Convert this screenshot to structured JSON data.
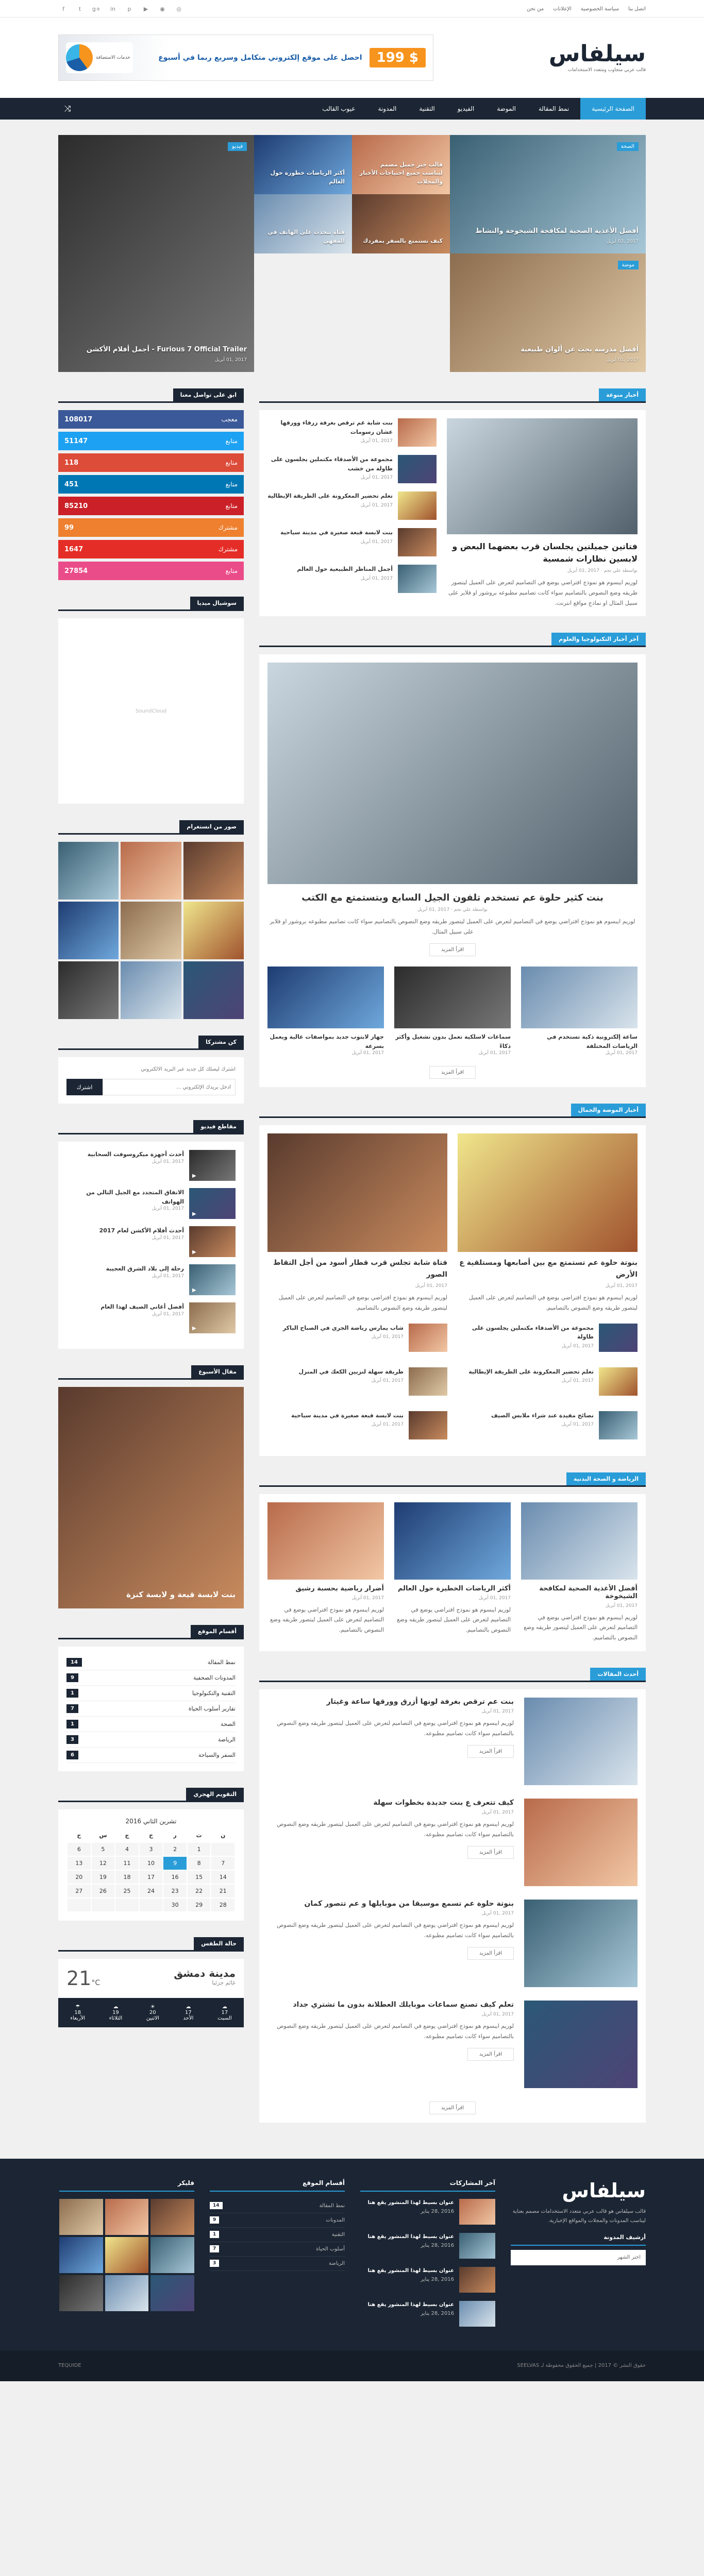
{
  "topbar": {
    "links": [
      "اتصل بنا",
      "سياسة الخصوصية",
      "الإعلانات",
      "من نحن"
    ],
    "socials": [
      "facebook-icon",
      "twitter-icon",
      "google-plus-icon",
      "linkedin-icon",
      "pinterest-icon",
      "youtube-icon",
      "rss-icon",
      "instagram-icon"
    ]
  },
  "header": {
    "logo": "سيلفاس",
    "tagline": "قالب عربي متجاوب ومتعدد الاستخدامات",
    "ad_text": "احصل على موقع إلكتروني متكامل وسريع ربما في أسبوع",
    "ad_brand": "خدمات الاستضافة",
    "ad_price": "199 $"
  },
  "nav": {
    "items": [
      "الصفحة الرئيسية",
      "نمط المقالة",
      "الموضة",
      "الفيديو",
      "التقنية",
      "المدونة",
      "عيوب القالب"
    ]
  },
  "slider": [
    {
      "title": "أفضل الأغذية الصحية لمكافحة الشيخوخة والنشاط",
      "meta": "2017 ,02 أبريل",
      "badge": "الصحة"
    },
    {
      "title": "قالب خبر جميل مصمم ليناسب جميع احتياجات الأخبار والمجلات",
      "meta": "2017 ,01 أبريل",
      "badge": "تقنية"
    },
    {
      "title": "أكثر الرياضات خطورة حول العالم",
      "meta": "2017 ,01 أبريل",
      "badge": "رياضة"
    },
    {
      "title": "كيف تستمتع بالسفر بمفردك",
      "meta": "2017 ,01 أبريل",
      "badge": "سفر"
    },
    {
      "title": "فتاة تتحدث على الهاتف في المقهى",
      "meta": "2017 ,01 أبريل",
      "badge": "أسلوب حياة"
    },
    {
      "title": "Furious 7 Official Trailer - أجمل أفلام الأكشن",
      "meta": "2017 ,01 أبريل",
      "badge": "فيديو"
    },
    {
      "title": "أفضل مدرسة بحث عن ألوان طبيعية",
      "meta": "2017 ,01 أبريل",
      "badge": "موضة"
    }
  ],
  "sections": {
    "news": "أخبار منوعة",
    "tech": "آخر أخبار التكنولوجيا والعلوم",
    "fashion": "أخبار الموضة والجمال",
    "sports": "الرياضة و الصحة البدنية",
    "latest": "أحدث المقالات"
  },
  "featured": {
    "title": "فتاتين جميلتين يجلسان قرب بعضهما البعض و لابسين نظارات شمسية",
    "meta": "بواسطة علي نجم · 2017 ,01 أبريل",
    "excerpt": "لوريم ايبسوم هو نموذج افتراضي يوضع في التصاميم لتعرض على العميل ليتصور طريقه وضع النصوص بالتصاميم سواء كانت تصاميم مطبوعه بروشور او فلاير على سبيل المثال او نماذج مواقع انترنت.",
    "list": [
      {
        "t": "بنت شابة عم ترقص بغرفة زرقاء وورقها عشان رسومات",
        "m": "2017 ,01 أبريل"
      },
      {
        "t": "مجموعة من الأصدقاء مكتملين يجلسون على طاولة من خشب",
        "m": "2017 ,01 أبريل"
      },
      {
        "t": "تعلم تحضير المعكرونة على الطريقة الإيطالية",
        "m": "2017 ,01 أبريل"
      },
      {
        "t": "بنت لابسة قبعة صغيرة في مدينة سياحية",
        "m": "2017 ,01 أبريل"
      },
      {
        "t": "أجمل المناظر الطبيعية حول العالم",
        "m": "2017 ,01 أبريل"
      }
    ]
  },
  "tech": {
    "title": "بنت كثير حلوة عم تستخدم تلفون الجيل السابع وبتستمتع مع الكتب",
    "meta": "بواسطة علي نجم · 2017 ,01 أبريل",
    "excerpt": "لوريم ايبسوم هو نموذج افتراضي يوضع في التصاميم لتعرض على العميل ليتصور طريقه وضع النصوص بالتصاميم سواء كانت تصاميم مطبوعه بروشور او فلاير على سبيل المثال.",
    "more": "اقرأ المزيد",
    "cards": [
      {
        "t": "ساعة إلكترونية ذكية تستخدم في الرياضات المختلفة",
        "m": "2017 ,01 أبريل"
      },
      {
        "t": "سماعات لاسلكية تعمل بدون تشغيل وأكثر ذكاءً",
        "m": "2017 ,01 أبريل"
      },
      {
        "t": "جهاز لابتوب جديد بمواصفات عالية ويعمل بسرعة",
        "m": "2017 ,01 أبريل"
      }
    ]
  },
  "fashion": {
    "a": {
      "t": "بنوتة حلوة عم تستمتع مع بين أصابعها ومستلقية ع الأرض",
      "m": "2017 ,01 أبريل"
    },
    "b": {
      "t": "فتاة شابة تجلس قرب قطار أسود من أجل التقاط الصور",
      "m": "2017 ,01 أبريل"
    },
    "excerpt": "لوريم ايبسوم هو نموذج افتراضي يوضع في التصاميم لتعرض على العميل ليتصور طريقه وضع النصوص بالتصاميم.",
    "list": [
      {
        "t": "مجموعة من الأصدقاء مكتملين يجلسون على طاولة",
        "m": "2017 ,01 أبريل"
      },
      {
        "t": "شاب يمارس رياضة الجري في الصباح الباكر",
        "m": "2017 ,01 أبريل"
      },
      {
        "t": "تعلم تحضير المعكرونة على الطريقة الإيطالية",
        "m": "2017 ,01 أبريل"
      },
      {
        "t": "طريقة سهلة لتزيين الكعك في المنزل",
        "m": "2017 ,01 أبريل"
      },
      {
        "t": "نصائح مفيدة عند شراء ملابس الصيف",
        "m": "2017 ,01 أبريل"
      },
      {
        "t": "بنت لابسة قبعة صغيرة في مدينة سياحية",
        "m": "2017 ,01 أبريل"
      }
    ]
  },
  "sports": [
    {
      "t": "أفضل الأغذية الصحية لمكافحة الشيخوخة",
      "m": "2017 ,01 أبريل"
    },
    {
      "t": "أكثر الرياضات الخطيرة حول العالم",
      "m": "2017 ,01 أبريل"
    },
    {
      "t": "أضرار رياضية بحسبة رشيق",
      "m": "2017 ,01 أبريل"
    }
  ],
  "latest": [
    {
      "t": "بنت عم ترقص بغرفة لونها أزرق وورقها ساعة وغيتار",
      "m": "2017 ,01 أبريل"
    },
    {
      "t": "كيف تتعرف ع بنت جديدة بخطوات سهلة",
      "m": "2017 ,01 أبريل"
    },
    {
      "t": "بنوتة حلوة عم تسمع موسيقا من موبايلها و عم تتصور كمان",
      "m": "2017 ,01 أبريل"
    },
    {
      "t": "تعلم كيف تصنع سماعات موبايلك العطلانة بدون ما تشتري جداد",
      "m": "2017 ,01 أبريل"
    }
  ],
  "latest_excerpt": "لوريم ايبسوم هو نموذج افتراضي يوضع في التصاميم لتعرض على العميل ليتصور طريقه وضع النصوص بالتصاميم سواء كانت تصاميم مطبوعه.",
  "sidebar": {
    "counter_title": "ابق على تواصل معنا",
    "counters": [
      {
        "name": "معجب",
        "value": "108017",
        "color": "#3b5998"
      },
      {
        "name": "متابع",
        "value": "51147",
        "color": "#1da1f2"
      },
      {
        "name": "متابع",
        "value": "118",
        "color": "#dd4b39"
      },
      {
        "name": "متابع",
        "value": "451",
        "color": "#0077b5"
      },
      {
        "name": "متابع",
        "value": "85210",
        "color": "#cb2027"
      },
      {
        "name": "مشترك",
        "value": "99",
        "color": "#ee802f"
      },
      {
        "name": "مشترك",
        "value": "1647",
        "color": "#e52d27"
      },
      {
        "name": "متابع",
        "value": "27854",
        "color": "#ea4c89"
      }
    ],
    "social_title": "سوشيال ميديا",
    "insta_title": "صور من انستغرام",
    "newsletter_title": "كن مشتركا",
    "newsletter_text": "اشترك ليصلك كل جديد عبر البريد الالكتروني",
    "newsletter_placeholder": "أدخل بريدك الإلكتروني ...",
    "newsletter_btn": "اشترك",
    "videos_title": "مقاطع فيديو",
    "videos": [
      {
        "t": "أحدث أجهزة ميكروسوفت السحابية",
        "m": "2017 ,01 أبريل"
      },
      {
        "t": "الاتفاق المتجدد مع الجيل التالي من الهواتف",
        "m": "2017 ,01 أبريل"
      },
      {
        "t": "أحدث أفلام الأكشن لعام 2017",
        "m": "2017 ,01 أبريل"
      },
      {
        "t": "رحلة إلى بلاد الشرق العجيبة",
        "m": "2017 ,01 أبريل"
      },
      {
        "t": "أفضل أغاني الصيف لهذا العام",
        "m": "2017 ,01 أبريل"
      }
    ],
    "post_title": "مقال الأسبوع",
    "post_caption": "بنت لابسة قبعة و لابسة كنزة",
    "cats_title": "أقسام الموقع",
    "cats": [
      {
        "n": "نمط المقالة",
        "c": "14"
      },
      {
        "n": "المدونات الصحفية",
        "c": "9"
      },
      {
        "n": "التقنية والتكنولوجيا",
        "c": "1"
      },
      {
        "n": "تقارير أسلوب الحياة",
        "c": "7"
      },
      {
        "n": "الصحة",
        "c": "1"
      },
      {
        "n": "الرياضة",
        "c": "3"
      },
      {
        "n": "السفر والسياحة",
        "c": "6"
      }
    ],
    "cal_title": "التقويم الهجري",
    "cal_month": "تشرين الثاني 2016",
    "cal_days": [
      "ن",
      "ث",
      "ر",
      "خ",
      "ج",
      "س",
      "ح"
    ],
    "cal_weeks": [
      [
        "",
        "1",
        "2",
        "3",
        "4",
        "5",
        "6"
      ],
      [
        "7",
        "8",
        "9",
        "10",
        "11",
        "12",
        "13"
      ],
      [
        "14",
        "15",
        "16",
        "17",
        "18",
        "19",
        "20"
      ],
      [
        "21",
        "22",
        "23",
        "24",
        "25",
        "26",
        "27"
      ],
      [
        "28",
        "29",
        "30",
        "",
        "",
        "",
        ""
      ]
    ],
    "cal_today": "9",
    "weather_title": "حالة الطقس",
    "weather_city": "مدينة دمشق",
    "weather_desc": "غائم جزئيا",
    "weather_temp": "21",
    "weather_unit": "°C",
    "weather_days": [
      {
        "d": "السبت",
        "t": "17"
      },
      {
        "d": "الأحد",
        "t": "17"
      },
      {
        "d": "الاثنين",
        "t": "20"
      },
      {
        "d": "الثلاثاء",
        "t": "19"
      },
      {
        "d": "الأربعاء",
        "t": "18"
      }
    ]
  },
  "footer": {
    "about_logo": "سيلفاس",
    "about_text": "قالب سيلفاس هو قالب عربي متعدد الاستخدامات مصمم بعناية ليناسب المدونات والمجلات والمواقع الإخبارية.",
    "archive_label": "أرشيف المدونة",
    "archive_value": "اختر الشهر",
    "posts_title": "آخر المشاركات",
    "posts": [
      {
        "t": "عنوان بسيط لهذا المنشور يقع هنا",
        "m": "2016 ,28 يناير"
      },
      {
        "t": "عنوان بسيط لهذا المنشور يقع هنا",
        "m": "2016 ,28 يناير"
      },
      {
        "t": "عنوان بسيط لهذا المنشور يقع هنا",
        "m": "2016 ,28 يناير"
      },
      {
        "t": "عنوان بسيط لهذا المنشور يقع هنا",
        "m": "2016 ,28 يناير"
      }
    ],
    "cats_title": "أقسام الموقع",
    "cats": [
      {
        "n": "نمط المقالة",
        "c": "14"
      },
      {
        "n": "المدونات",
        "c": "9"
      },
      {
        "n": "التقنية",
        "c": "1"
      },
      {
        "n": "أسلوب الحياة",
        "c": "7"
      },
      {
        "n": "الرياضة",
        "c": "3"
      }
    ],
    "gallery_title": "فليكر",
    "copyright": "حقوق النشر © 2017 | جميع الحقوق محفوظة لـ SEELVAS",
    "designer": "TEQUIDE"
  }
}
